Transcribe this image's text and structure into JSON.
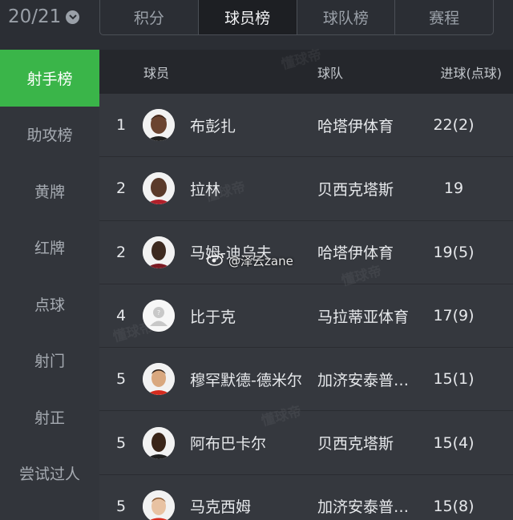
{
  "season": {
    "label": "20/21"
  },
  "tabs": [
    {
      "label": "积分",
      "active": false
    },
    {
      "label": "球员榜",
      "active": true
    },
    {
      "label": "球队榜",
      "active": false
    },
    {
      "label": "赛程",
      "active": false
    }
  ],
  "sidebar": {
    "items": [
      {
        "label": "射手榜",
        "active": true
      },
      {
        "label": "助攻榜",
        "active": false
      },
      {
        "label": "黄牌",
        "active": false
      },
      {
        "label": "红牌",
        "active": false
      },
      {
        "label": "点球",
        "active": false
      },
      {
        "label": "射门",
        "active": false
      },
      {
        "label": "射正",
        "active": false
      },
      {
        "label": "尝试过人",
        "active": false
      }
    ]
  },
  "table": {
    "headers": {
      "player": "球员",
      "team": "球队",
      "goals": "进球(点球)"
    },
    "rows": [
      {
        "rank": "1",
        "name": "布彭扎",
        "team": "哈塔伊体育",
        "goals": "22(2)"
      },
      {
        "rank": "2",
        "name": "拉林",
        "team": "贝西克塔斯",
        "goals": "19"
      },
      {
        "rank": "2",
        "name": "马姆-迪乌夫",
        "team": "哈塔伊体育",
        "goals": "19(5)"
      },
      {
        "rank": "4",
        "name": "比于克",
        "team": "马拉蒂亚体育",
        "goals": "17(9)"
      },
      {
        "rank": "5",
        "name": "穆罕默德-德米尔",
        "team": "加济安泰普体育",
        "goals": "15(1)"
      },
      {
        "rank": "5",
        "name": "阿布巴卡尔",
        "team": "贝西克塔斯",
        "goals": "15(4)"
      },
      {
        "rank": "5",
        "name": "马克西姆",
        "team": "加济安泰普体育",
        "goals": "15(8)"
      }
    ]
  },
  "watermark": {
    "text": "懂球帝"
  },
  "weibo": {
    "text": "@泽云zane"
  }
}
